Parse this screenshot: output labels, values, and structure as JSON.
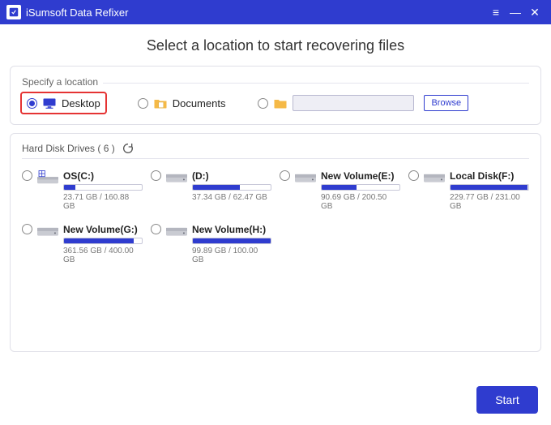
{
  "app": {
    "title": "iSumsoft Data Refixer"
  },
  "heading": "Select a location to start recovering files",
  "locations": {
    "panel_title": "Specify a location",
    "desktop_label": "Desktop",
    "documents_label": "Documents",
    "browse_label": "Browse",
    "path_value": ""
  },
  "drives_section": {
    "title_prefix": "Hard Disk Drives",
    "count_label": "( 6 )"
  },
  "drives": [
    {
      "name": "OS(C:)",
      "used": 23.71,
      "total": 160.88,
      "size_text": "23.71 GB / 160.88 GB",
      "system": true
    },
    {
      "name": "(D:)",
      "used": 37.34,
      "total": 62.47,
      "size_text": "37.34 GB / 62.47 GB",
      "system": false
    },
    {
      "name": "New Volume(E:)",
      "used": 90.69,
      "total": 200.5,
      "size_text": "90.69 GB / 200.50 GB",
      "system": false
    },
    {
      "name": "Local Disk(F:)",
      "used": 229.77,
      "total": 231.0,
      "size_text": "229.77 GB / 231.00 GB",
      "system": false
    },
    {
      "name": "New Volume(G:)",
      "used": 361.56,
      "total": 400.0,
      "size_text": "361.56 GB / 400.00 GB",
      "system": false
    },
    {
      "name": "New Volume(H:)",
      "used": 99.89,
      "total": 100.0,
      "size_text": "99.89 GB / 100.00 GB",
      "system": false
    }
  ],
  "footer": {
    "start_label": "Start"
  },
  "colors": {
    "accent": "#2f3ccf",
    "highlight": "#e53333"
  }
}
